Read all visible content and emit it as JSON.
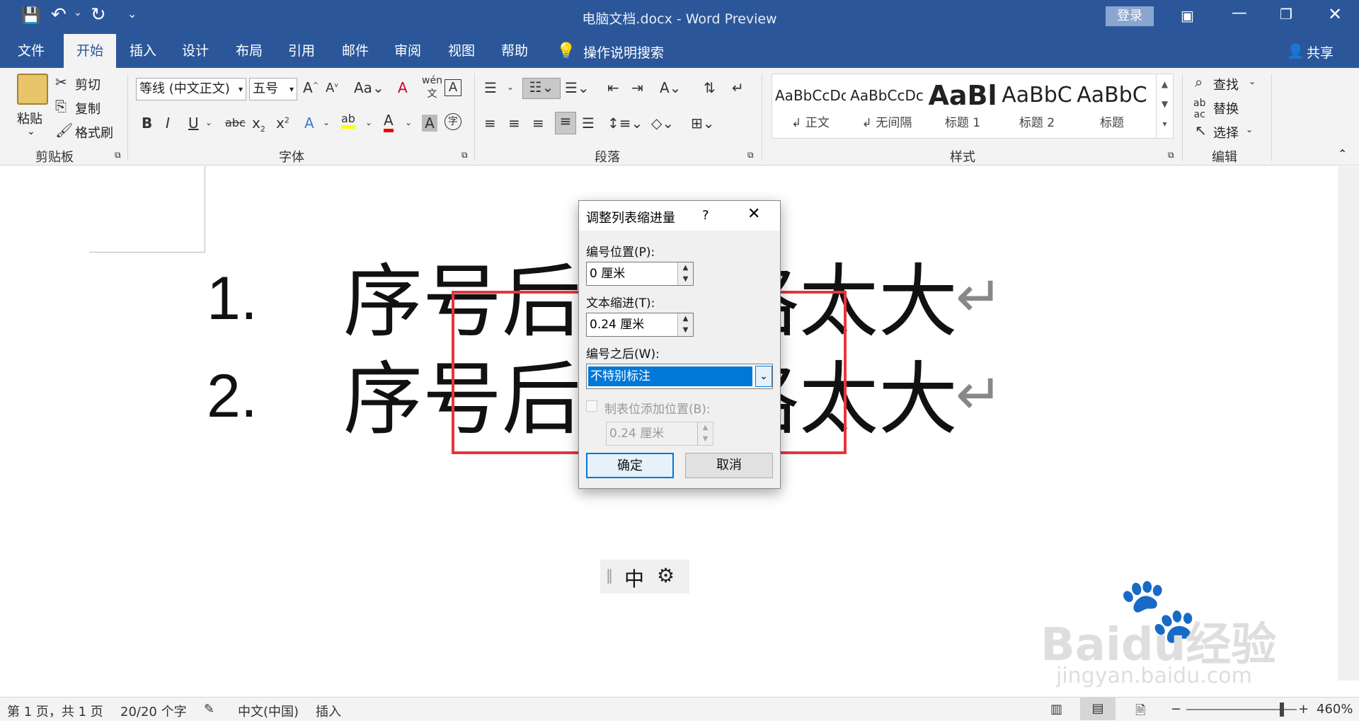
{
  "titlebar": {
    "title": "电脑文档.docx  -  Word Preview",
    "login": "登录",
    "qat_dropdown": "⌄"
  },
  "tabs": [
    {
      "label": "文件"
    },
    {
      "label": "开始"
    },
    {
      "label": "插入"
    },
    {
      "label": "设计"
    },
    {
      "label": "布局"
    },
    {
      "label": "引用"
    },
    {
      "label": "邮件"
    },
    {
      "label": "审阅"
    },
    {
      "label": "视图"
    },
    {
      "label": "帮助"
    }
  ],
  "search_tell": "操作说明搜索",
  "share": "共享",
  "clipboard": {
    "paste": "粘贴",
    "cut": "剪切",
    "copy": "复制",
    "format_painter": "格式刷",
    "group_label": "剪贴板"
  },
  "font": {
    "font_name": "等线 (中文正文)",
    "font_size": "五号",
    "group_label": "字体"
  },
  "paragraph": {
    "group_label": "段落"
  },
  "styles": {
    "items": [
      {
        "preview": "AaBbCcDc",
        "label": "↲ 正文"
      },
      {
        "preview": "AaBbCcDc",
        "label": "↲ 无间隔"
      },
      {
        "preview": "AaBl",
        "label": "标题 1"
      },
      {
        "preview": "AaBbC",
        "label": "标题 2"
      },
      {
        "preview": "AaBbC",
        "label": "标题"
      }
    ],
    "group_label": "样式"
  },
  "editing": {
    "find": "查找",
    "replace": "替换",
    "select": "选择",
    "group_label": "编辑"
  },
  "document": {
    "lines": [
      {
        "number": "1.",
        "text": "序号后面空格太大",
        "visible_left": "序号后面",
        "visible_right": "格太大"
      },
      {
        "number": "2.",
        "text": "序号后面空格太大",
        "visible_left": "序号后面",
        "visible_right": "格太大"
      }
    ],
    "return_mark": "↵"
  },
  "dialog": {
    "title": "调整列表缩进量",
    "help": "?",
    "number_position_label": "编号位置(P):",
    "number_position_value": "0 厘米",
    "text_indent_label": "文本缩进(T):",
    "text_indent_value": "0.24 厘米",
    "follow_number_label": "编号之后(W):",
    "follow_number_value": "不特别标注",
    "tab_stop_label": "制表位添加位置(B):",
    "tab_stop_value": "0.24 厘米",
    "ok": "确定",
    "cancel": "取消"
  },
  "ime": {
    "mode": "中"
  },
  "statusbar": {
    "page": "第 1 页，共 1 页",
    "words": "20/20 个字",
    "language": "中文(中国)",
    "insert": "插入",
    "zoom": "460%"
  },
  "watermark": {
    "brand": "Baidu经验",
    "url": "jingyan.baidu.com"
  },
  "colors": {
    "accent": "#2b579a",
    "highlight": "#e9343c",
    "selection": "#0078d7"
  }
}
